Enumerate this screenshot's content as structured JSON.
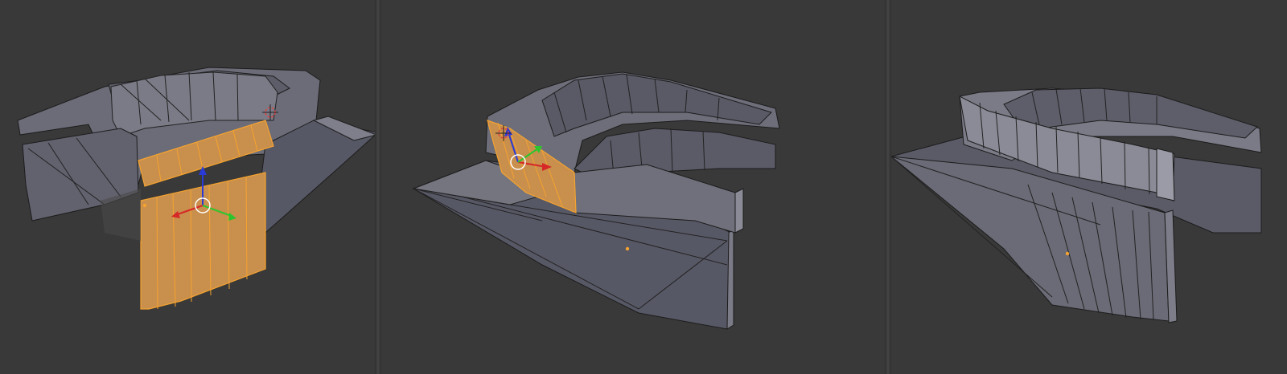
{
  "viewports": [
    {
      "name": "viewport-left",
      "selected_faces": 1
    },
    {
      "name": "viewport-middle",
      "selected_faces": 1
    },
    {
      "name": "viewport-right",
      "selected_faces": 0
    }
  ],
  "colors": {
    "background": "#393939",
    "mesh_face": "#6e6f7a",
    "mesh_face_dark": "#50505c",
    "mesh_face_light": "#8a8b98",
    "edge": "#1a1a1a",
    "selected_face": "#c9914f",
    "selected_edge": "#f5a330",
    "gizmo_x": "#d62828",
    "gizmo_y": "#2ec42e",
    "gizmo_z": "#2a3ad6"
  },
  "icons": [
    "transform-gizmo-icon",
    "3d-cursor-icon",
    "object-origin-icon"
  ]
}
